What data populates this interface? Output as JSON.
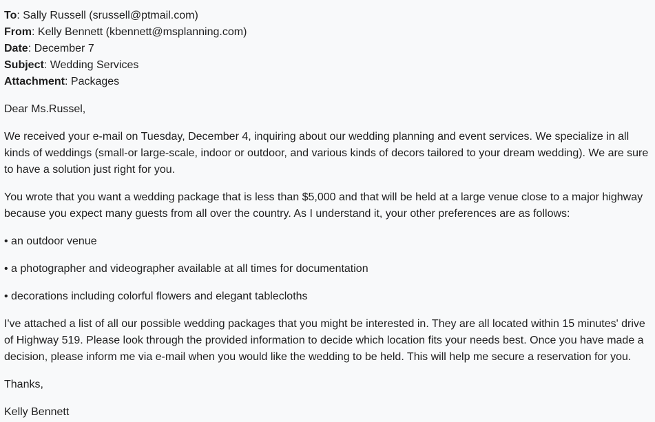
{
  "headers": {
    "to_label": "To",
    "to_value": ": Sally Russell (srussell@ptmail.com)",
    "from_label": "From",
    "from_value": ": Kelly Bennett (kbennett@msplanning.com)",
    "date_label": "Date",
    "date_value": ": December 7",
    "subject_label": "Subject",
    "subject_value": ": Wedding Services",
    "attachment_label": "Attachment",
    "attachment_value": ": Packages"
  },
  "body": {
    "greeting": "Dear Ms.Russel,",
    "paragraph_1": "We received your e-mail on Tuesday, December 4, inquiring about our wedding planning and event services. We specialize in all kinds of weddings (small-or large-scale, indoor or outdoor, and various kinds of decors tailored to your dream wedding). We are sure to have a solution just right for you.",
    "paragraph_2": "You wrote that you want a wedding package that is less than $5,000 and that will be held at a large venue close to a major highway because you expect many guests from all over the country. As I understand it, your other preferences are as follows:",
    "bullets": [
      "• an outdoor venue",
      "• a photographer and videographer available at all times for documentation",
      "• decorations including colorful flowers and elegant tablecloths"
    ],
    "paragraph_3": "I've attached a list of all our possible wedding packages that you might be interested in. They are all located within 15 minutes' drive of Highway 519. Please look through the provided information to decide which location fits your needs best. Once you have made a decision, please inform me via e-mail when you would like the wedding to be held. This will help me secure a reservation for you.",
    "closing": "Thanks,",
    "signature": "Kelly Bennett"
  }
}
